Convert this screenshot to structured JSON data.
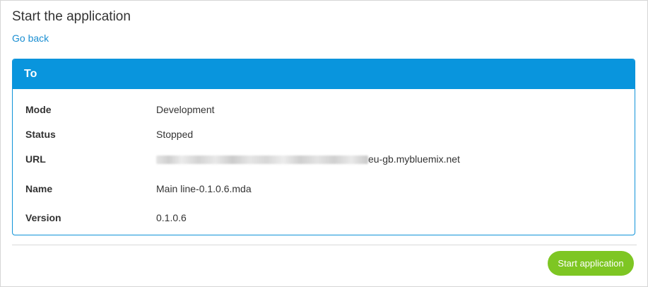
{
  "page": {
    "title": "Start the application",
    "back_link": "Go back"
  },
  "panel": {
    "header": "To",
    "rows": [
      {
        "label": "Mode",
        "value": "Development"
      },
      {
        "label": "Status",
        "value": "Stopped"
      },
      {
        "label": "URL",
        "value": "eu-gb.mybluemix.net"
      },
      {
        "label": "Name",
        "value": "Main line-0.1.0.6.mda"
      },
      {
        "label": "Version",
        "value": "0.1.0.6"
      }
    ]
  },
  "actions": {
    "start_label": "Start application"
  },
  "colors": {
    "header_bg": "#0995dd",
    "link": "#1b8fd2",
    "start_button": "#7ec623"
  }
}
